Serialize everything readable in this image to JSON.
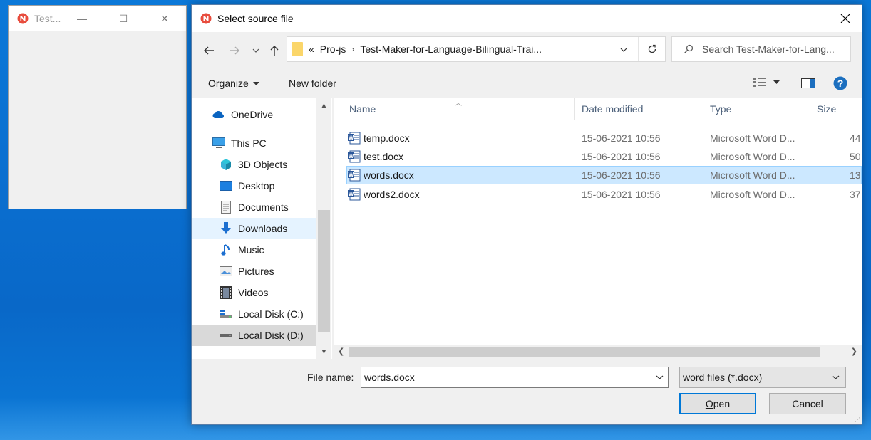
{
  "app_window": {
    "title": "Test...",
    "minimize_label": "—",
    "maximize_label": "☐",
    "close_label": "✕"
  },
  "dialog": {
    "title": "Select source file",
    "close_label": "✕"
  },
  "address_bar": {
    "overflow_label": "«",
    "crumbs": [
      "Pro-js",
      "Test-Maker-for-Language-Bilingual-Trai..."
    ],
    "separator": "›"
  },
  "search": {
    "placeholder": "Search Test-Maker-for-Lang..."
  },
  "toolbar": {
    "organize_label": "Organize",
    "new_folder_label": "New folder"
  },
  "nav": {
    "items": [
      {
        "label": "OneDrive",
        "icon": "cloud-icon"
      },
      {
        "label": "This PC",
        "icon": "computer-icon"
      },
      {
        "label": "3D Objects",
        "icon": "cube-icon"
      },
      {
        "label": "Desktop",
        "icon": "desktop-icon"
      },
      {
        "label": "Documents",
        "icon": "document-icon"
      },
      {
        "label": "Downloads",
        "icon": "download-icon"
      },
      {
        "label": "Music",
        "icon": "music-icon"
      },
      {
        "label": "Pictures",
        "icon": "pictures-icon"
      },
      {
        "label": "Videos",
        "icon": "video-icon"
      },
      {
        "label": "Local Disk (C:)",
        "icon": "drive-icon"
      },
      {
        "label": "Local Disk (D:)",
        "icon": "drive-icon"
      }
    ]
  },
  "files": {
    "columns": [
      "Name",
      "Date modified",
      "Type",
      "Size"
    ],
    "rows": [
      {
        "name": "temp.docx",
        "date": "15-06-2021 10:56",
        "type": "Microsoft Word D...",
        "size": "44"
      },
      {
        "name": "test.docx",
        "date": "15-06-2021 10:56",
        "type": "Microsoft Word D...",
        "size": "50"
      },
      {
        "name": "words.docx",
        "date": "15-06-2021 10:56",
        "type": "Microsoft Word D...",
        "size": "13"
      },
      {
        "name": "words2.docx",
        "date": "15-06-2021 10:56",
        "type": "Microsoft Word D...",
        "size": "37"
      }
    ]
  },
  "bottom": {
    "file_name_label_pre": "File ",
    "file_name_label_accel": "n",
    "file_name_label_post": "ame:",
    "file_name_value": "words.docx",
    "filter_value": "word files (*.docx)",
    "open_label_accel": "O",
    "open_label_rest": "pen",
    "cancel_label": "Cancel"
  },
  "colors": {
    "accent": "#0078d7",
    "selection": "#cce8ff",
    "desktop": "#0b78d8"
  }
}
